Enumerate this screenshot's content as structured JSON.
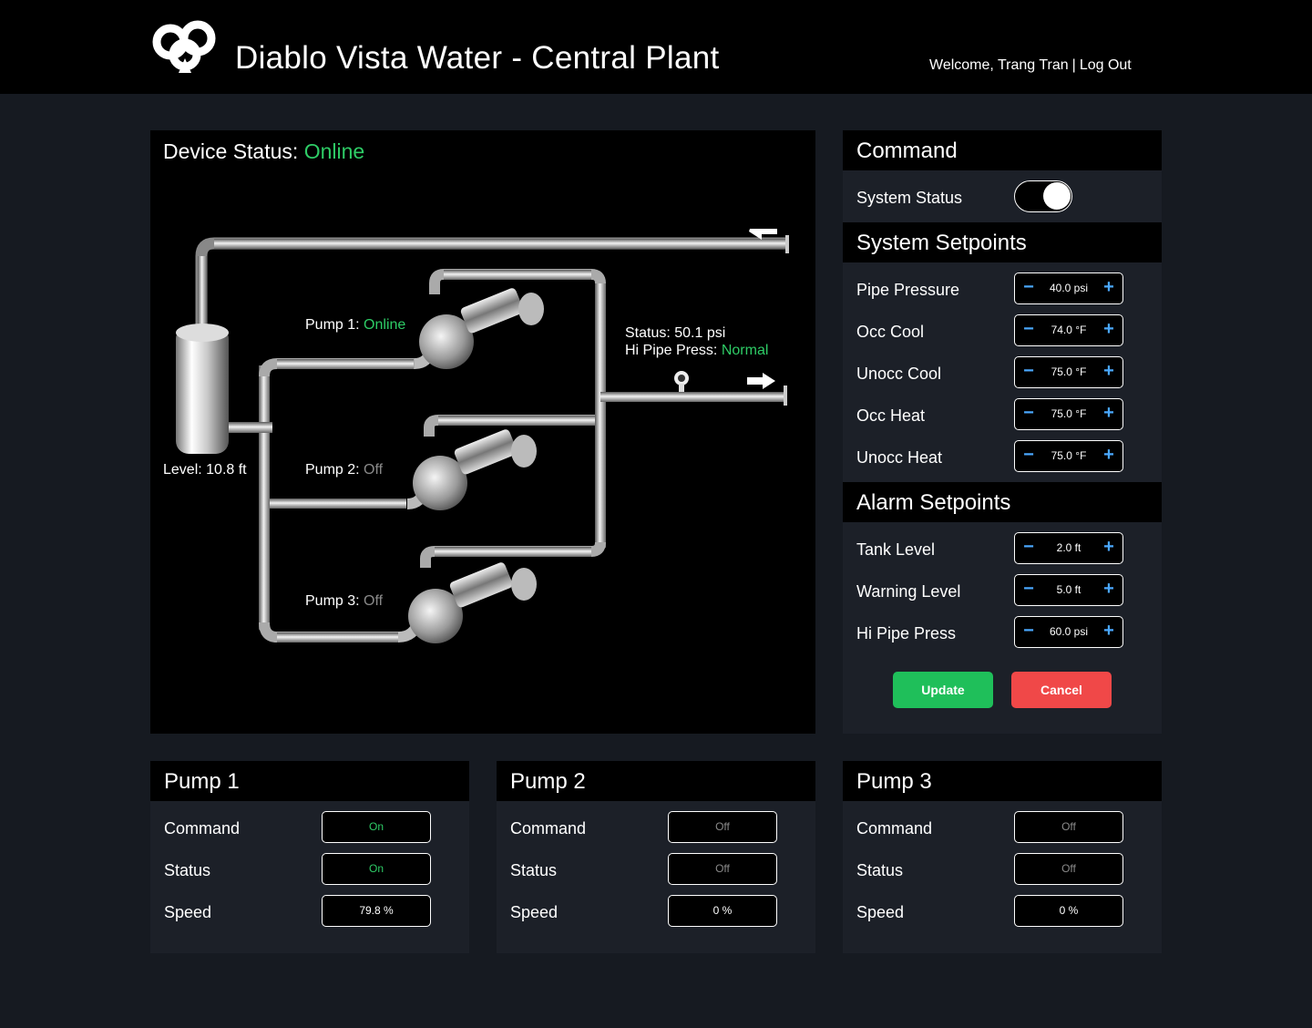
{
  "header": {
    "title": "Diablo Vista Water - Central Plant",
    "welcome": "Welcome, Trang Tran",
    "separator": "|",
    "logout": "Log Out"
  },
  "device": {
    "status_label": "Device Status:",
    "status_value": "Online",
    "pump1_label": "Pump 1:",
    "pump1_value": "Online",
    "pump2_label": "Pump 2:",
    "pump2_value": "Off",
    "pump3_label": "Pump 3:",
    "pump3_value": "Off",
    "level_text": "Level: 10.8 ft",
    "pressure_text": "Status: 50.1 psi",
    "hi_press_label": "Hi Pipe Press:",
    "hi_press_value": "Normal"
  },
  "command": {
    "title": "Command",
    "system_status_label": "System Status",
    "system_status_on": true
  },
  "system_setpoints": {
    "title": "System Setpoints",
    "items": [
      {
        "label": "Pipe Pressure",
        "value": "40.0 psi"
      },
      {
        "label": "Occ Cool",
        "value": "74.0 °F"
      },
      {
        "label": "Unocc Cool",
        "value": "75.0 °F"
      },
      {
        "label": "Occ Heat",
        "value": "75.0 °F"
      },
      {
        "label": "Unocc Heat",
        "value": "75.0 °F"
      }
    ]
  },
  "alarm_setpoints": {
    "title": "Alarm Setpoints",
    "items": [
      {
        "label": "Tank Level",
        "value": "2.0 ft"
      },
      {
        "label": "Warning Level",
        "value": "5.0 ft"
      },
      {
        "label": "Hi Pipe Press",
        "value": "60.0 psi"
      }
    ]
  },
  "controls": {
    "minus": "−",
    "plus": "+"
  },
  "buttons": {
    "update": "Update",
    "cancel": "Cancel"
  },
  "pumps": [
    {
      "title": "Pump 1",
      "command_label": "Command",
      "command": "On",
      "status_label": "Status",
      "status": "On",
      "speed_label": "Speed",
      "speed": "79.8 %"
    },
    {
      "title": "Pump 2",
      "command_label": "Command",
      "command": "Off",
      "status_label": "Status",
      "status": "Off",
      "speed_label": "Speed",
      "speed": "0 %"
    },
    {
      "title": "Pump 3",
      "command_label": "Command",
      "command": "Off",
      "status_label": "Status",
      "status": "Off",
      "speed_label": "Speed",
      "speed": "0 %"
    }
  ],
  "colors": {
    "online": "#2ecc66",
    "off": "#8a8a8a",
    "accent": "#4aa8ff",
    "update": "#1fbf5a",
    "cancel": "#f04848"
  }
}
